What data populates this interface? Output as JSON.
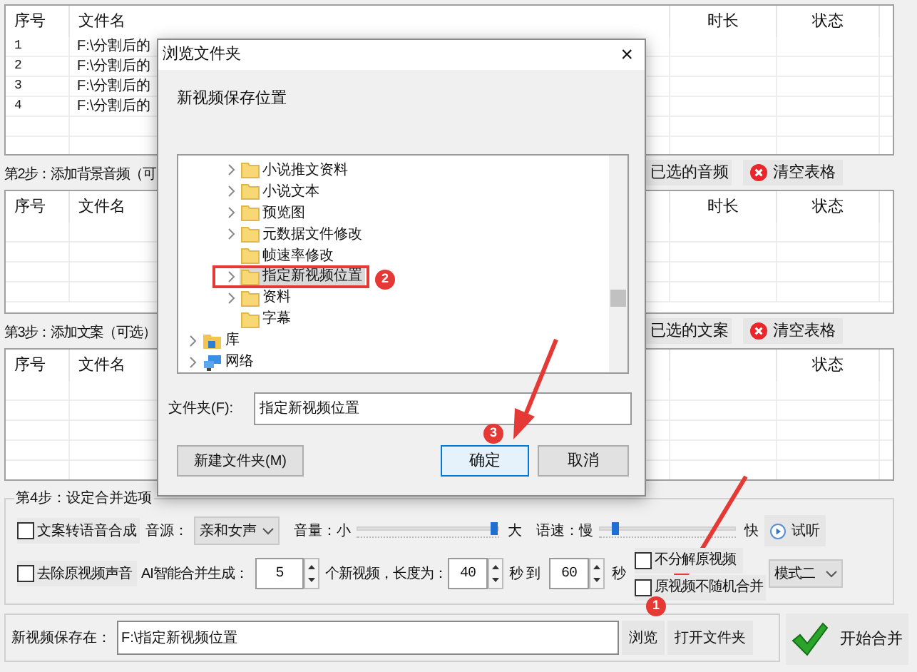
{
  "table1": {
    "columns": [
      "序号",
      "文件名",
      "时长",
      "状态"
    ],
    "rows": [
      {
        "index": "1",
        "file": "F:\\分割后的"
      },
      {
        "index": "2",
        "file": "F:\\分割后的"
      },
      {
        "index": "3",
        "file": "F:\\分割后的"
      },
      {
        "index": "4",
        "file": "F:\\分割后的"
      }
    ]
  },
  "step2": {
    "label": "第2步：添加背景音频（可",
    "buttons": [
      {
        "kind": "remove",
        "label": "已选的音频"
      },
      {
        "kind": "clear",
        "label": "清空表格"
      }
    ]
  },
  "table2": {
    "columns": [
      "序号",
      "文件名",
      "时长",
      "状态"
    ]
  },
  "step3": {
    "label": "第3步：添加文案（可选）",
    "buttons": [
      {
        "kind": "remove",
        "label": "已选的文案"
      },
      {
        "kind": "clear",
        "label": "清空表格"
      }
    ]
  },
  "table3": {
    "columns": [
      "序号",
      "文件名",
      "",
      "状态"
    ]
  },
  "step4": {
    "title": "第4步：设定合并选项",
    "tts": {
      "label": "文案转语音合成",
      "checked": false
    },
    "voice_label": "音源：",
    "voice": "亲和女声",
    "volume": {
      "label": "音量：小",
      "max": "大",
      "level": 0.97
    },
    "speed": {
      "label": "语速：慢",
      "max": "快",
      "level": 0.12
    },
    "preview": "试听",
    "mute": {
      "label": "去除原视频声音",
      "checked": false
    },
    "ai_label": "AI智能合并生成：",
    "count": "5",
    "count_suffix": "个新视频，长度为：",
    "min": "40",
    "sec_to": "秒 到",
    "max": "60",
    "sec": "秒",
    "no_split": {
      "label": "不分解原视频",
      "checked": false
    },
    "no_random": {
      "label": "原视频不随机合并",
      "checked": false
    },
    "mode": "模式二"
  },
  "save": {
    "label": "新视频保存在：",
    "value": "F:\\指定新视频位置",
    "browse": "浏览",
    "open": "打开文件夹",
    "start": "开始合并"
  },
  "dialog": {
    "title": "浏览文件夹",
    "close": "×",
    "description": "新视频保存位置",
    "tree": [
      {
        "label": "小说推文资料",
        "kind": "folder",
        "has_children": true,
        "selected": false
      },
      {
        "label": "小说文本",
        "kind": "folder",
        "has_children": true,
        "selected": false
      },
      {
        "label": "预览图",
        "kind": "folder",
        "has_children": true,
        "selected": false
      },
      {
        "label": "元数据文件修改",
        "kind": "folder",
        "has_children": true,
        "selected": false
      },
      {
        "label": "帧速率修改",
        "kind": "folder",
        "has_children": false,
        "selected": false
      },
      {
        "label": "指定新视频位置",
        "kind": "folder",
        "has_children": true,
        "selected": true
      },
      {
        "label": "资料",
        "kind": "folder",
        "has_children": true,
        "selected": false
      },
      {
        "label": "字幕",
        "kind": "folder",
        "has_children": false,
        "selected": false
      },
      {
        "label": "库",
        "kind": "library",
        "has_children": true,
        "selected": false
      },
      {
        "label": "网络",
        "kind": "network",
        "has_children": true,
        "selected": false
      }
    ],
    "folder_label": "文件夹(F):",
    "folder_value": "指定新视频位置",
    "new_folder": "新建文件夹(M)",
    "ok": "确定",
    "cancel": "取消"
  },
  "badges": [
    "1",
    "2",
    "3"
  ]
}
